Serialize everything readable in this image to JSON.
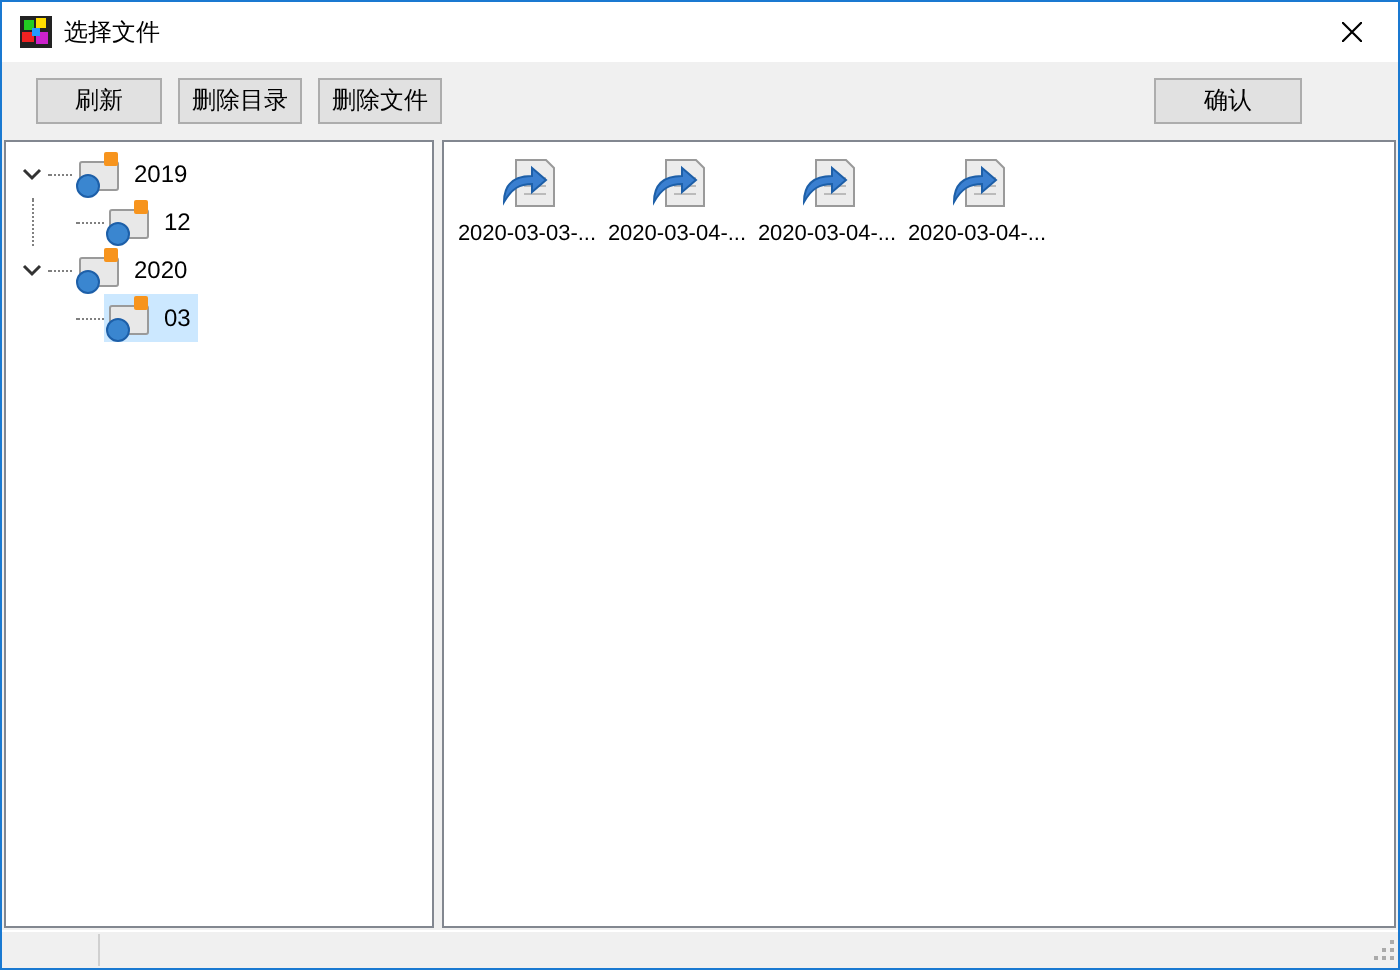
{
  "window": {
    "title": "选择文件"
  },
  "toolbar": {
    "buttons": [
      "刷新",
      "删除目录",
      "删除文件"
    ],
    "confirm": "确认"
  },
  "tree": [
    {
      "label": "2019",
      "expanded": true,
      "selected": false,
      "children": [
        {
          "label": "12",
          "selected": false
        }
      ]
    },
    {
      "label": "2020",
      "expanded": true,
      "selected": false,
      "children": [
        {
          "label": "03",
          "selected": true
        }
      ]
    }
  ],
  "files": [
    {
      "name": "2020-03-03-..."
    },
    {
      "name": "2020-03-04-..."
    },
    {
      "name": "2020-03-04-..."
    },
    {
      "name": "2020-03-04-..."
    }
  ]
}
